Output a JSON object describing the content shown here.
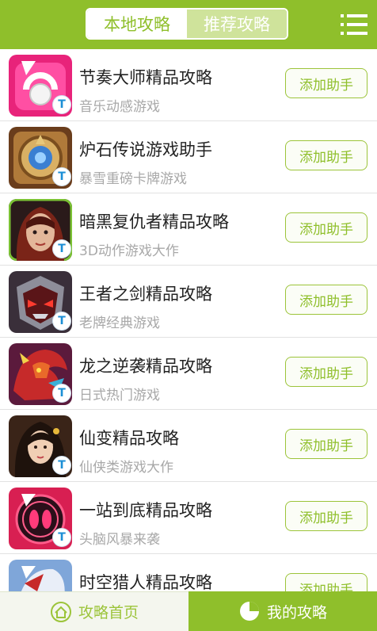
{
  "header": {
    "tabs": [
      {
        "label": "本地攻略",
        "active": true
      },
      {
        "label": "推荐攻略",
        "active": false
      }
    ],
    "menu_icon": "list-menu-icon"
  },
  "colors": {
    "accent": "#8fbf2b",
    "button_text": "#8fbf2b",
    "subtitle": "#a8a8a8"
  },
  "list": {
    "items": [
      {
        "title": "节奏大师精品攻略",
        "subtitle": "音乐动感游戏",
        "button": "添加助手",
        "icon": "rhythm-master-game-icon"
      },
      {
        "title": "炉石传说游戏助手",
        "subtitle": "暴雪重磅卡牌游戏",
        "button": "添加助手",
        "icon": "hearthstone-game-icon"
      },
      {
        "title": "暗黑复仇者精品攻略",
        "subtitle": "3D动作游戏大作",
        "button": "添加助手",
        "icon": "dark-avenger-game-icon"
      },
      {
        "title": "王者之剑精品攻略",
        "subtitle": "老牌经典游戏",
        "button": "添加助手",
        "icon": "sword-of-king-game-icon"
      },
      {
        "title": "龙之逆袭精品攻略",
        "subtitle": "日式热门游戏",
        "button": "添加助手",
        "icon": "dragon-revenge-game-icon"
      },
      {
        "title": "仙变精品攻略",
        "subtitle": "仙侠类游戏大作",
        "button": "添加助手",
        "icon": "xianbian-game-icon"
      },
      {
        "title": "一站到底精品攻略",
        "subtitle": "头脑风暴来袭",
        "button": "添加助手",
        "icon": "yizhandaodi-game-icon"
      },
      {
        "title": "时空猎人精品攻略",
        "subtitle": "",
        "button": "添加助手",
        "icon": "time-hunter-game-icon"
      }
    ],
    "badge_glyph": "T"
  },
  "footer": {
    "left_label": "攻略首页",
    "right_label": "我的攻略"
  }
}
